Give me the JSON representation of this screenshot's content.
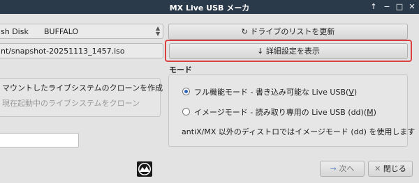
{
  "window": {
    "title": "MX Live USB メーカ",
    "controls": [
      "↑",
      "−",
      "□",
      "✕"
    ]
  },
  "device": {
    "label": "sh Disk",
    "vendor": "BUFFALO",
    "refresh_label": "ドライブのリストを更新",
    "refresh_icon": "↻"
  },
  "source": {
    "path": "nt/snapshot-20251113_1457.iso",
    "advanced_label": "詳細設定を表示",
    "advanced_icon": "↓"
  },
  "clone": {
    "option_label": "マウントしたライブシステムのクローンを作成",
    "suboption_label": "現在起動中のライブシステムをクローン"
  },
  "mode": {
    "heading": "モード",
    "full_label": "フル機能モード - 書き込み可能な Live USB(",
    "full_key": "V",
    "full_close": ")",
    "image_label": "イメージモード - 読み取り専用の Live USB (dd)(",
    "image_key": "M",
    "image_close": ")",
    "note": "antiX/MX 以外のディストロではイメージモード (dd) を使用します",
    "selected": "full"
  },
  "footer": {
    "next_icon": "→",
    "next_label": "次へ",
    "close_icon": "✕",
    "close_label": "閉じる"
  },
  "colors": {
    "titlebar": "#2b3a4a",
    "highlight": "#d94141",
    "radio_accent": "#2c64b8"
  }
}
